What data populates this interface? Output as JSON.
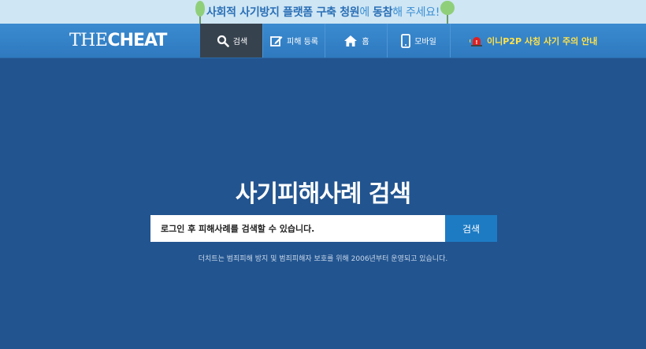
{
  "banner": {
    "part1": "사회적 사기방지 플랫폼 구축 청원",
    "part2": "에 ",
    "part3": "동참",
    "part4": "해 주세요!"
  },
  "header": {
    "logo_light": "THE",
    "logo_bold": "CHEAT"
  },
  "nav": {
    "search": "검색",
    "report": "피해 등록",
    "home": "홈",
    "mobile": "모바일"
  },
  "notice": {
    "text": "이니P2P 사칭 사기 주의 안내"
  },
  "hero": {
    "title": "사기피해사례 검색",
    "input_placeholder": "로그인 후 피해사례를 검색할 수 있습니다.",
    "search_button": "검색",
    "note": "더치트는 범죄피해 방지 및 범죄피해자 보호를 위해 2006년부터 운영되고 있습니다."
  },
  "colors": {
    "background": "#22548f",
    "navbar": "#3585c9",
    "active_nav": "#37424f",
    "notice": "#ffe24a",
    "search_button": "#1d7bc4"
  }
}
